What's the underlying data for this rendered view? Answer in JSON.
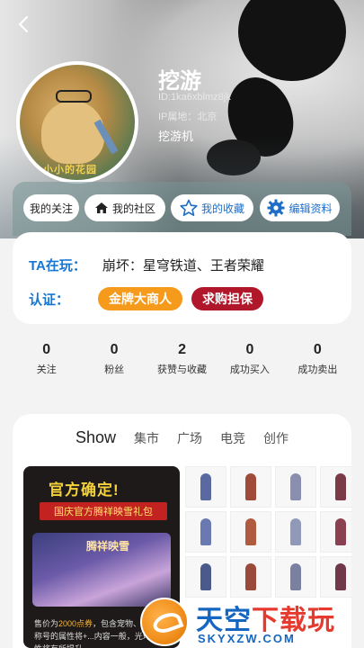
{
  "profile": {
    "name": "挖游",
    "id_text": "ID:1ka6xblmz8jk",
    "ip_text": "IP属地：北京",
    "bio": "挖游机",
    "avatar_caption": "小小的花园"
  },
  "actions": {
    "follow": "我的关注",
    "community": "我的社区",
    "collection": "我的收藏",
    "edit": "编辑资料"
  },
  "info": {
    "playing_label": "TA在玩：",
    "playing_value": "崩坏：星穹铁道、王者荣耀",
    "cert_label": "认证：",
    "badges": [
      "金牌大商人",
      "求购担保"
    ]
  },
  "stats": [
    {
      "value": "0",
      "label": "关注"
    },
    {
      "value": "0",
      "label": "粉丝"
    },
    {
      "value": "2",
      "label": "获赞与收藏"
    },
    {
      "value": "0",
      "label": "成功买入"
    },
    {
      "value": "0",
      "label": "成功卖出"
    }
  ],
  "tabs": [
    "Show",
    "集市",
    "广场",
    "电竞",
    "创作"
  ],
  "promo": {
    "headline": "官方确定!",
    "subline": "国庆官方腾祥映雪礼包",
    "art_title": "腾祥映雪",
    "desc_prefix": "售价为",
    "desc_highlight": "2000点券",
    "desc_rest": "，包含宠物、勋章、称号的属性将+...内容一般，光环的属性将有所提升"
  },
  "watermark": {
    "main_a": "天空",
    "main_b": "下载玩",
    "sub": "SKYXZW.COM"
  },
  "colors": {
    "accent_blue": "#1876d2",
    "badge_gold": "#f59a1b",
    "badge_red": "#b0172a"
  }
}
